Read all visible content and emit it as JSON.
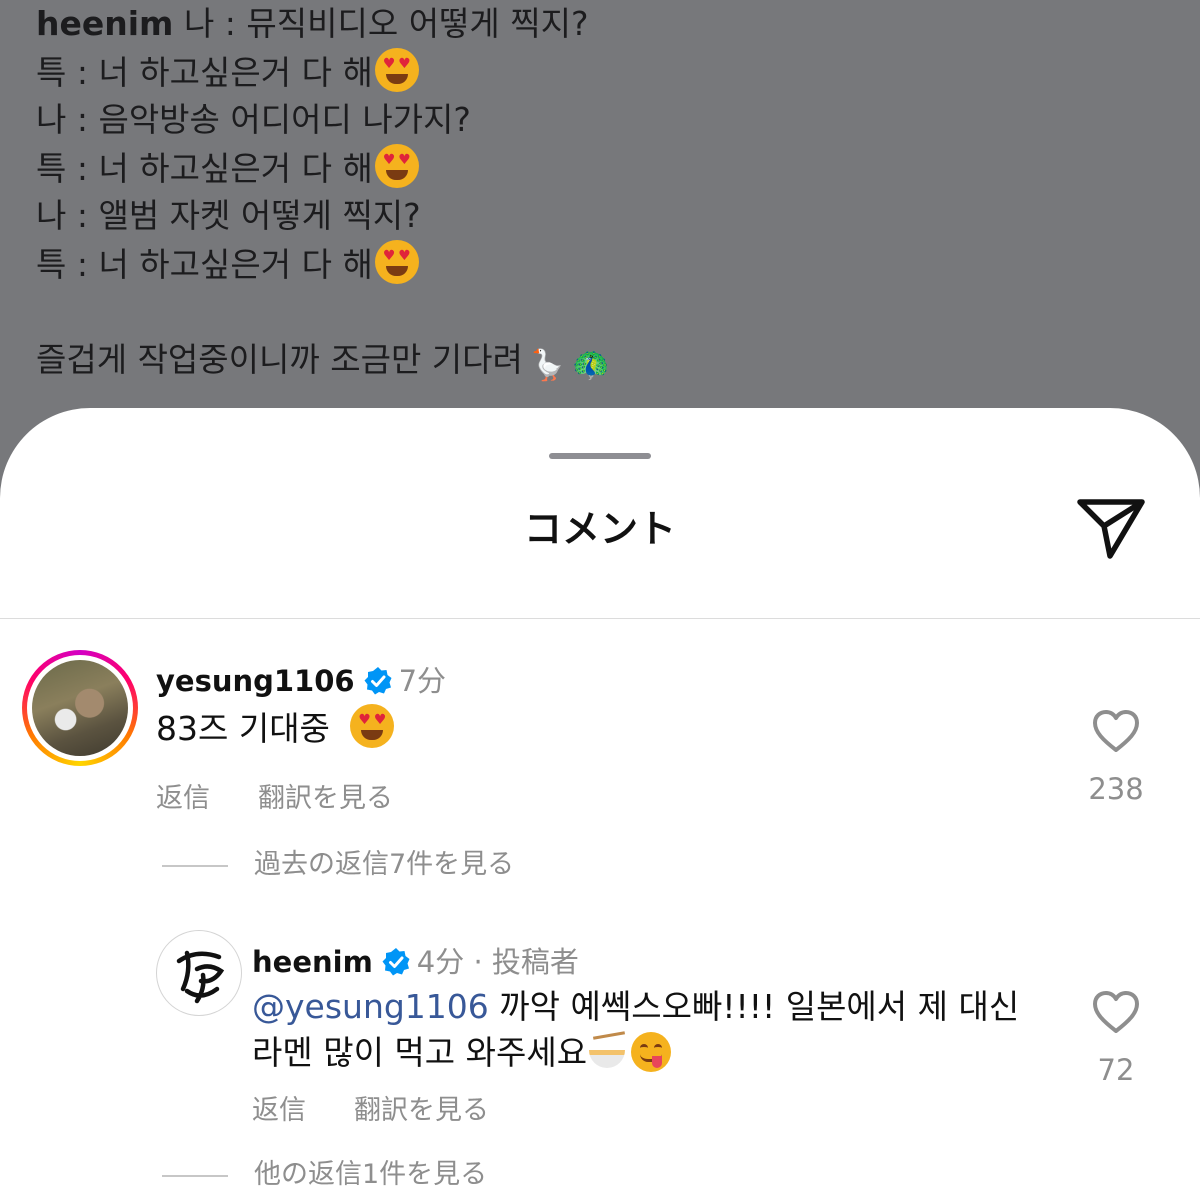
{
  "caption": {
    "author": "heenim",
    "lines": [
      "나 : 뮤직비디오 어떻게 찍지?",
      "특 : 너 하고싶은거 다 해",
      "나 : 음악방송 어디어디 나가지?",
      "특 : 너 하고싶은거 다 해",
      "나 : 앨범 자켓 어떻게 찍지?",
      "특 : 너 하고싶은거 다 해"
    ],
    "closing": "즐겁게 작업중이니까 조금만 기다려",
    "closing_emojis": [
      "goose-emoji",
      "peacock-emoji"
    ]
  },
  "sheet": {
    "title": "コメント",
    "share_icon": "paper-plane-icon"
  },
  "comments": [
    {
      "username": "yesung1106",
      "verified": true,
      "time": "7分",
      "text": "83즈 기대중",
      "emoji": "heart-eyes-emoji",
      "reply_label": "返信",
      "translate_label": "翻訳を見る",
      "likes": "238",
      "view_replies": "過去の返信7件を見る"
    },
    {
      "username": "heenim",
      "verified": true,
      "time": "4分",
      "author_badge": "投稿者",
      "mention": "@yesung1106",
      "text_line1": "까악 예쎅스오빠!!!! 일본에서 제 대신",
      "text_line2": "라멘 많이 먹고 와주세요",
      "emojis": [
        "ramen-emoji",
        "yum-emoji"
      ],
      "reply_label": "返信",
      "translate_label": "翻訳を見る",
      "likes": "72",
      "view_replies": "他の返信1件を見る"
    }
  ],
  "colors": {
    "overlay_bg": "#77787b",
    "verified_blue": "#0095f6",
    "mention_blue": "#385898",
    "meta_gray": "#8e8e8e"
  }
}
